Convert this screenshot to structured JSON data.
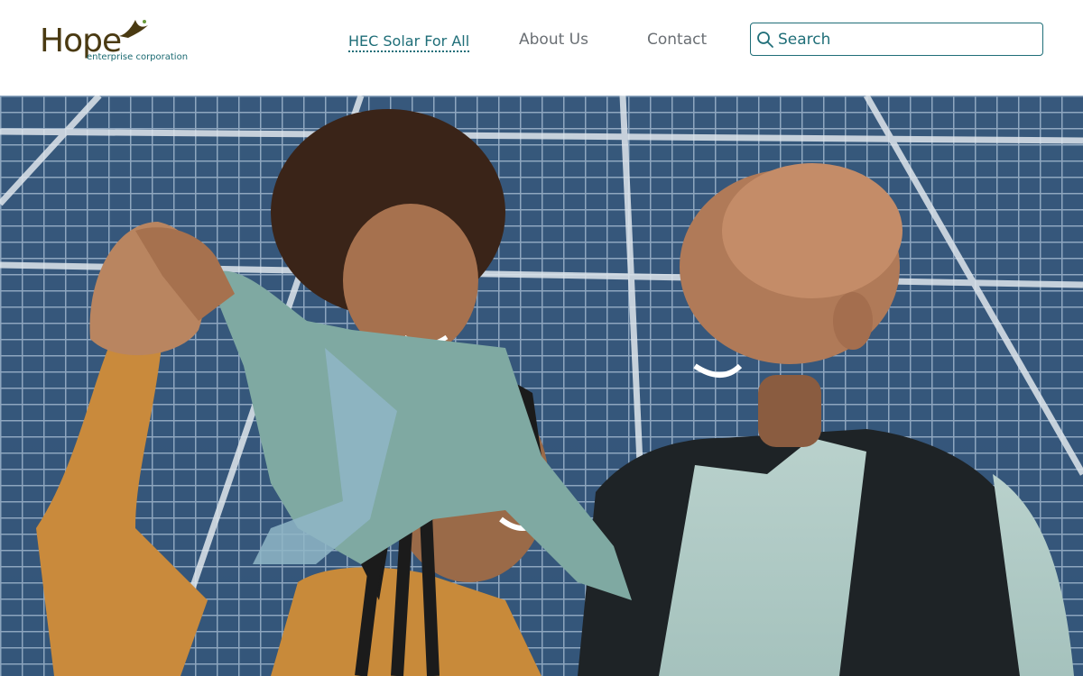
{
  "brand": {
    "name": "Hope",
    "tagline": "enterprise corporation"
  },
  "nav": {
    "items": [
      {
        "label": "HEC Solar For All",
        "active": true
      },
      {
        "label": "About Us",
        "active": false
      },
      {
        "label": "Contact",
        "active": false
      }
    ]
  },
  "search": {
    "placeholder": "Search",
    "value": ""
  },
  "hero": {
    "image": "family-in-front-of-solar-panels"
  },
  "colors": {
    "accent": "#1f6e78",
    "brand_brown": "#4a3a12",
    "nav_text": "#6a6f74",
    "panel_blue": "#24476b"
  }
}
